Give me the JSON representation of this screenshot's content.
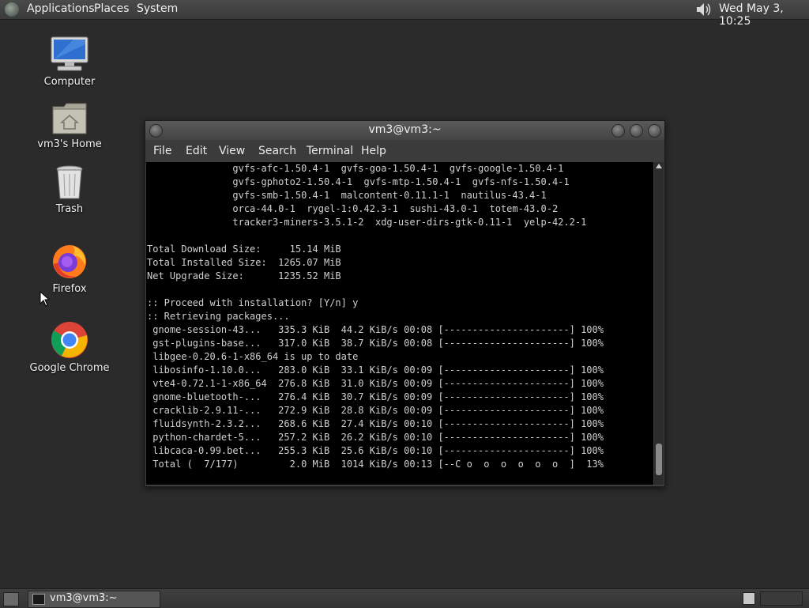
{
  "top_panel": {
    "menus": [
      "Applications",
      "Places",
      "System"
    ],
    "clock": "Wed May  3, 10:25"
  },
  "desktop": {
    "icons": [
      {
        "label": "Computer",
        "icon": "computer-icon"
      },
      {
        "label": "vm3's Home",
        "icon": "home-folder-icon"
      },
      {
        "label": "Trash",
        "icon": "trash-icon"
      },
      {
        "label": "Firefox",
        "icon": "firefox-icon"
      },
      {
        "label": "Google Chrome",
        "icon": "chrome-icon"
      }
    ]
  },
  "terminal": {
    "title": "vm3@vm3:~",
    "menus": [
      "File",
      "Edit",
      "View",
      "Search",
      "Terminal",
      "Help"
    ],
    "lines": [
      "               gvfs-afc-1.50.4-1  gvfs-goa-1.50.4-1  gvfs-google-1.50.4-1",
      "               gvfs-gphoto2-1.50.4-1  gvfs-mtp-1.50.4-1  gvfs-nfs-1.50.4-1",
      "               gvfs-smb-1.50.4-1  malcontent-0.11.1-1  nautilus-43.4-1",
      "               orca-44.0-1  rygel-1:0.42.3-1  sushi-43.0-1  totem-43.0-2",
      "               tracker3-miners-3.5.1-2  xdg-user-dirs-gtk-0.11-1  yelp-42.2-1",
      "",
      "Total Download Size:     15.14 MiB",
      "Total Installed Size:  1265.07 MiB",
      "Net Upgrade Size:      1235.52 MiB",
      "",
      ":: Proceed with installation? [Y/n] y",
      ":: Retrieving packages...",
      " gnome-session-43...   335.3 KiB  44.2 KiB/s 00:08 [----------------------] 100%",
      " gst-plugins-base...   317.0 KiB  38.7 KiB/s 00:08 [----------------------] 100%",
      " libgee-0.20.6-1-x86_64 is up to date",
      " libosinfo-1.10.0...   283.0 KiB  33.1 KiB/s 00:09 [----------------------] 100%",
      " vte4-0.72.1-1-x86_64  276.8 KiB  31.0 KiB/s 00:09 [----------------------] 100%",
      " gnome-bluetooth-...   276.4 KiB  30.7 KiB/s 00:09 [----------------------] 100%",
      " cracklib-2.9.11-...   272.9 KiB  28.8 KiB/s 00:09 [----------------------] 100%",
      " fluidsynth-2.3.2...   268.6 KiB  27.4 KiB/s 00:10 [----------------------] 100%",
      " python-chardet-5...   257.2 KiB  26.2 KiB/s 00:10 [----------------------] 100%",
      " libcaca-0.99.bet...   255.3 KiB  25.6 KiB/s 00:10 [----------------------] 100%",
      " Total (  7/177)         2.0 MiB  1014 KiB/s 00:13 [--C o  o  o  o  o  o  ]  13%"
    ]
  },
  "taskbar": {
    "task_label": "vm3@vm3:~"
  }
}
